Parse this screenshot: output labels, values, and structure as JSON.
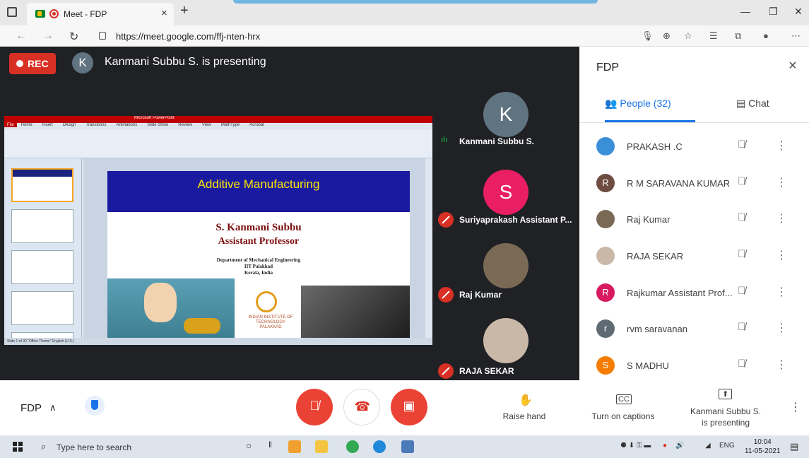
{
  "browser": {
    "tab_title": "Meet - FDP",
    "tab_close": "×",
    "new_tab": "+",
    "url": "https://meet.google.com/ffj-nten-hrx"
  },
  "meet": {
    "rec_label": "REC",
    "presenter_initial": "K",
    "presenting_text": "Kanmani Subbu S. is presenting"
  },
  "slide": {
    "header": "Additive Manufacturing",
    "name": "S. Kanmani Subbu",
    "role": "Assistant Professor",
    "dept_line1": "Department of Mechanical Engineering",
    "dept_line2": "IIT Palakkad",
    "dept_line3": "Kerala, India",
    "logo_text": "INDIAN INSTITUTE OF TECHNOLOGY PALAKKAD",
    "ppt_tabs": [
      "File",
      "Home",
      "Insert",
      "Design",
      "Transitions",
      "Animations",
      "Slide Show",
      "Review",
      "View",
      "MathType",
      "Acrobat"
    ],
    "status_text": "Slide 1 of 30  \"Office Theme\"  English (U.S.)"
  },
  "tiles": [
    {
      "initial": "K",
      "name": "Kanmani Subbu S.",
      "color": "#5f7380",
      "speaking": true
    },
    {
      "initial": "S",
      "name": "Suriyaprakash Assistant P...",
      "color": "#e91e63",
      "speaking": false
    },
    {
      "initial": "",
      "name": "Raj Kumar",
      "color": "#7a6a55",
      "speaking": false
    },
    {
      "initial": "",
      "name": "RAJA SEKAR",
      "color": "#c9b8a8",
      "speaking": false
    }
  ],
  "panel": {
    "title": "FDP",
    "close": "×",
    "people_tab": "People (32)",
    "chat_tab": "Chat",
    "people": [
      {
        "initial": "",
        "name": "PRAKASH .C",
        "color": "#3b8ed8"
      },
      {
        "initial": "R",
        "name": "R M SARAVANA KUMAR",
        "color": "#6d4c41"
      },
      {
        "initial": "",
        "name": "Raj Kumar",
        "color": "#7a6a55"
      },
      {
        "initial": "",
        "name": "RAJA SEKAR",
        "color": "#c9b8a8"
      },
      {
        "initial": "R",
        "name": "Rajkumar Assistant Prof...",
        "color": "#d81b60"
      },
      {
        "initial": "r",
        "name": "rvm saravanan",
        "color": "#5f6b73"
      },
      {
        "initial": "S",
        "name": "S MADHU",
        "color": "#f57c00"
      }
    ]
  },
  "controls": {
    "meeting_name": "FDP",
    "raise_hand": "Raise hand",
    "captions": "Turn on captions",
    "presenting_line1": "Kanmani Subbu S.",
    "presenting_line2": "is presenting"
  },
  "taskbar": {
    "search_placeholder": "Type here to search",
    "time": "10:04",
    "date": "11-05-2021",
    "lang": "ENG"
  }
}
